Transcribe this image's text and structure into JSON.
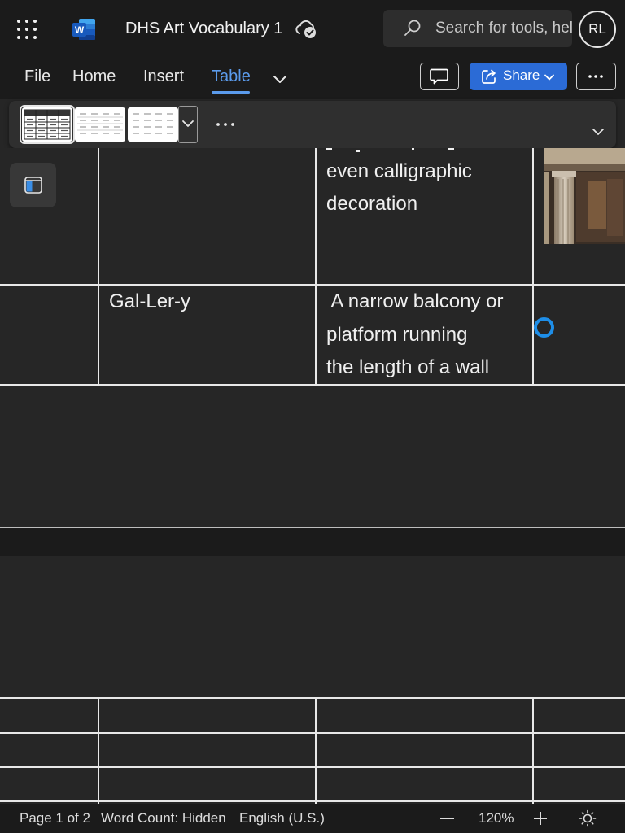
{
  "app": {
    "document_title": "DHS Art Vocabulary 1",
    "user_initials": "RL",
    "search": {
      "placeholder": "Search for tools, help, and more"
    }
  },
  "ribbon": {
    "tabs": [
      {
        "label": "File"
      },
      {
        "label": "Home"
      },
      {
        "label": "Insert"
      },
      {
        "label": "Table",
        "active": true
      }
    ],
    "share_label": "Share",
    "table_styles": [
      "grid-table-dark-header",
      "grid-table-light",
      "plain-table-light"
    ]
  },
  "document": {
    "rows": [
      {
        "term": "",
        "definition_lines": [
          "even calligraphic",
          "decoration"
        ]
      },
      {
        "term": "Gal-Ler-y",
        "definition_lines": [
          " A narrow balcony or",
          "platform running",
          "the length of a wall"
        ]
      }
    ]
  },
  "status": {
    "page": "Page 1 of 2",
    "word_count": "Word Count: Hidden",
    "language": "English (U.S.)",
    "zoom": "120%"
  },
  "colors": {
    "accent": "#5b9bec",
    "share_button": "#2b6bd6",
    "canvas": "#262626",
    "chrome": "#1b1b1b",
    "cursor": "#1e8ee8"
  },
  "icons": [
    "app-launcher-icon",
    "word-logo-icon",
    "cloud-saved-icon",
    "search-icon",
    "chevron-down-icon",
    "comment-icon",
    "share-icon",
    "more-icon",
    "side-panel-icon",
    "zoom-out-icon",
    "zoom-in-icon",
    "brightness-icon"
  ]
}
